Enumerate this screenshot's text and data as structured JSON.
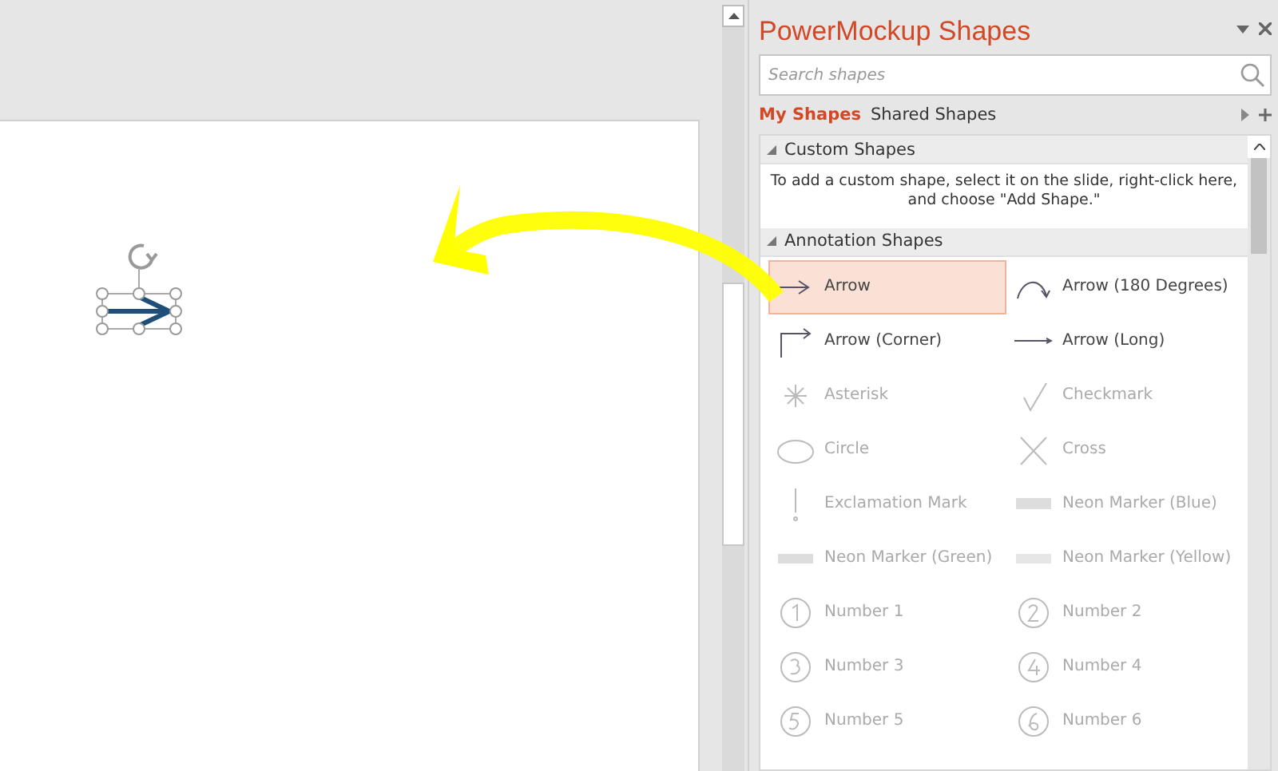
{
  "panel": {
    "title": "PowerMockup Shapes",
    "search": {
      "placeholder": "Search shapes"
    },
    "tabs": [
      {
        "label": "My Shapes",
        "selected": true
      },
      {
        "label": "Shared Shapes",
        "selected": false
      }
    ],
    "sections": [
      {
        "title": "Custom Shapes",
        "expanded": true,
        "note": "To add a custom shape, select it on the slide, right-click here, and choose \"Add Shape.\""
      },
      {
        "title": "Annotation Shapes",
        "expanded": true,
        "items": [
          {
            "label": "Arrow",
            "selected": true,
            "dimmed": false
          },
          {
            "label": "Arrow (180 Degrees)",
            "selected": false,
            "dimmed": false
          },
          {
            "label": "Arrow (Corner)",
            "selected": false,
            "dimmed": false
          },
          {
            "label": "Arrow (Long)",
            "selected": false,
            "dimmed": false
          },
          {
            "label": "Asterisk",
            "selected": false,
            "dimmed": true
          },
          {
            "label": "Checkmark",
            "selected": false,
            "dimmed": true
          },
          {
            "label": "Circle",
            "selected": false,
            "dimmed": true
          },
          {
            "label": "Cross",
            "selected": false,
            "dimmed": true
          },
          {
            "label": "Exclamation Mark",
            "selected": false,
            "dimmed": true
          },
          {
            "label": "Neon Marker (Blue)",
            "selected": false,
            "dimmed": true
          },
          {
            "label": "Neon Marker (Green)",
            "selected": false,
            "dimmed": true
          },
          {
            "label": "Neon Marker (Yellow)",
            "selected": false,
            "dimmed": true
          },
          {
            "label": "Number 1",
            "selected": false,
            "dimmed": true
          },
          {
            "label": "Number 2",
            "selected": false,
            "dimmed": true
          },
          {
            "label": "Number 3",
            "selected": false,
            "dimmed": true
          },
          {
            "label": "Number 4",
            "selected": false,
            "dimmed": true
          },
          {
            "label": "Number 5",
            "selected": false,
            "dimmed": true
          },
          {
            "label": "Number 6",
            "selected": false,
            "dimmed": true
          }
        ]
      }
    ]
  }
}
